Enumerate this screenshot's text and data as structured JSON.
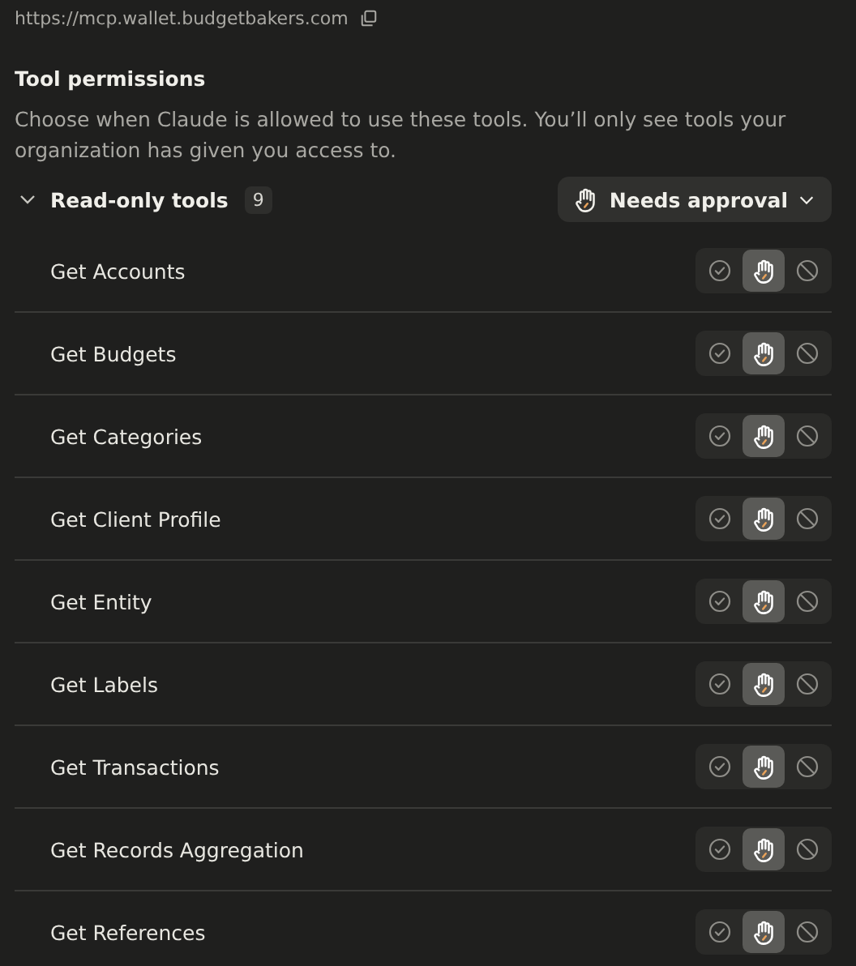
{
  "server_url": "https://mcp.wallet.budgetbakers.com",
  "section": {
    "title": "Tool permissions",
    "description": "Choose when Claude is allowed to use these tools. You’ll only see tools your organization has given you access to."
  },
  "group": {
    "name": "Read-only tools",
    "count": "9",
    "expanded": true,
    "bulk_permission": {
      "kind": "approval",
      "label": "Needs approval"
    }
  },
  "tools": [
    {
      "name": "Get Accounts",
      "options": [
        {
          "kind": "allow",
          "selected": false
        },
        {
          "kind": "approval",
          "selected": true
        },
        {
          "kind": "block",
          "selected": false
        }
      ]
    },
    {
      "name": "Get Budgets",
      "options": [
        {
          "kind": "allow",
          "selected": false
        },
        {
          "kind": "approval",
          "selected": true
        },
        {
          "kind": "block",
          "selected": false
        }
      ]
    },
    {
      "name": "Get Categories",
      "options": [
        {
          "kind": "allow",
          "selected": false
        },
        {
          "kind": "approval",
          "selected": true
        },
        {
          "kind": "block",
          "selected": false
        }
      ]
    },
    {
      "name": "Get Client Profile",
      "options": [
        {
          "kind": "allow",
          "selected": false
        },
        {
          "kind": "approval",
          "selected": true
        },
        {
          "kind": "block",
          "selected": false
        }
      ]
    },
    {
      "name": "Get Entity",
      "options": [
        {
          "kind": "allow",
          "selected": false
        },
        {
          "kind": "approval",
          "selected": true
        },
        {
          "kind": "block",
          "selected": false
        }
      ]
    },
    {
      "name": "Get Labels",
      "options": [
        {
          "kind": "allow",
          "selected": false
        },
        {
          "kind": "approval",
          "selected": true
        },
        {
          "kind": "block",
          "selected": false
        }
      ]
    },
    {
      "name": "Get Transactions",
      "options": [
        {
          "kind": "allow",
          "selected": false
        },
        {
          "kind": "approval",
          "selected": true
        },
        {
          "kind": "block",
          "selected": false
        }
      ]
    },
    {
      "name": "Get Records Aggregation",
      "options": [
        {
          "kind": "allow",
          "selected": false
        },
        {
          "kind": "approval",
          "selected": true
        },
        {
          "kind": "block",
          "selected": false
        }
      ]
    },
    {
      "name": "Get References",
      "options": [
        {
          "kind": "allow",
          "selected": false
        },
        {
          "kind": "approval",
          "selected": true
        },
        {
          "kind": "block",
          "selected": false
        }
      ]
    }
  ]
}
